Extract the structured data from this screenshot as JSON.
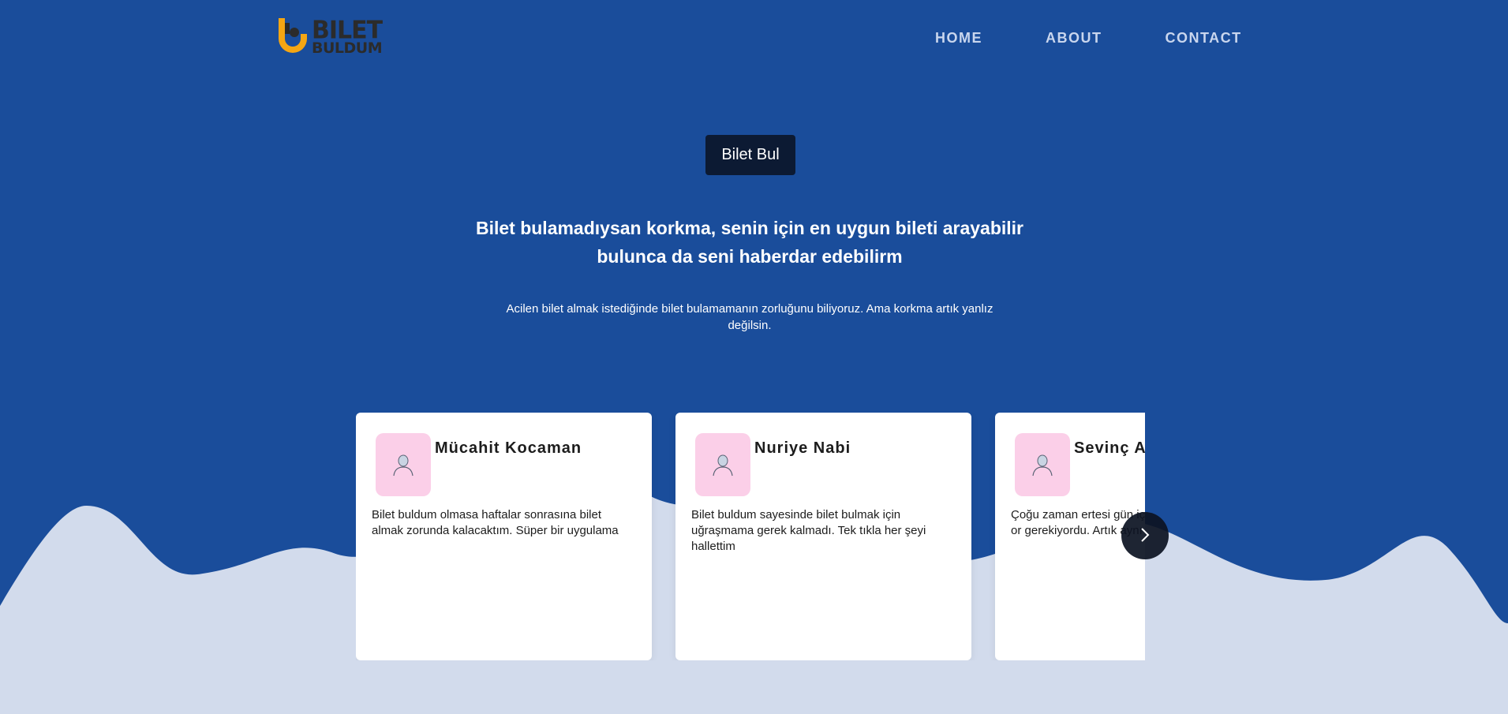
{
  "brand": {
    "logo_line1": "BILET",
    "logo_line2": "BULDUM",
    "logo_accent_color": "#f5a613"
  },
  "nav": {
    "items": [
      {
        "label": "HOME"
      },
      {
        "label": "ABOUT"
      },
      {
        "label": "CONTACT"
      }
    ]
  },
  "hero": {
    "cta_label": "Bilet Bul",
    "headline": "Bilet bulamadıysan korkma, senin için en uygun bileti arayabilir bulunca da seni haberdar edebilirm",
    "subtext": "Acilen bilet almak istediğinde bilet bulamamanın zorluğunu biliyoruz. Ama korkma artık yanlız değilsin."
  },
  "testimonials": [
    {
      "name": "Mücahit Kocaman",
      "quote": "Bilet buldum olmasa haftalar sonrasına bilet almak zorunda kalacaktım. Süper bir uygulama",
      "avatar_icon": "user-icon"
    },
    {
      "name": "Nuriye Nabi",
      "quote": "Bilet buldum sayesinde bilet bulmak için uğraşmama gerek kalmadı. Tek tıkla her şeyi hallettim",
      "avatar_icon": "user-icon"
    },
    {
      "name": "Sevinç A",
      "quote": "Çoğu zaman ertesi gün iç oluyordu o yüzden çok or gerekiyordu. Artık aynı gü bulabiliyorum.",
      "avatar_icon": "user-icon"
    }
  ],
  "carousel": {
    "next_icon": "chevron-right-icon"
  },
  "colors": {
    "background": "#1a4d9b",
    "wave": "#d2dbec",
    "cta_bg": "#0c1a33",
    "avatar_bg": "#fbcfe8"
  }
}
